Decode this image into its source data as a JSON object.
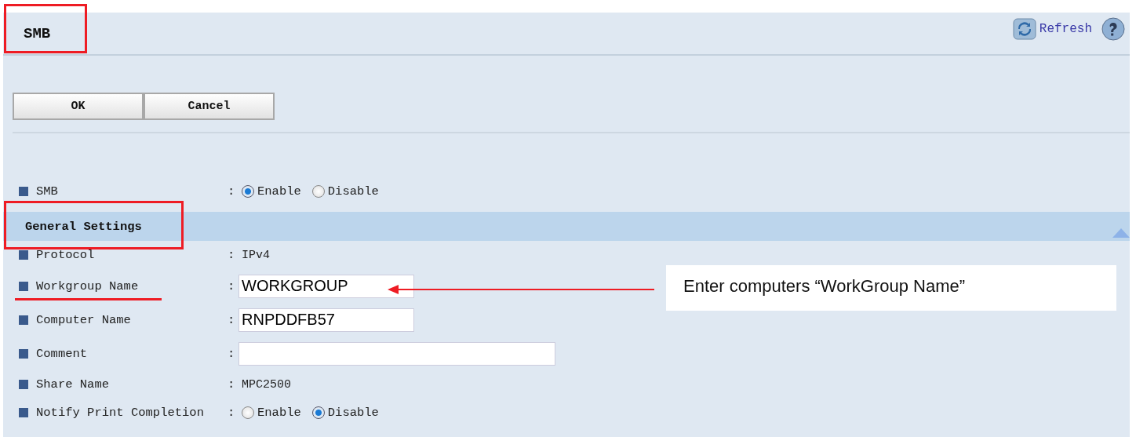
{
  "header": {
    "title": "SMB",
    "refresh": "Refresh"
  },
  "buttons": [
    "OK",
    "Cancel"
  ],
  "top_rows": [
    {
      "kind": "radio",
      "label": "SMB",
      "separator": ":",
      "options": [
        {
          "label": "Enable",
          "selected": true
        },
        {
          "label": "Disable",
          "selected": false
        }
      ]
    }
  ],
  "section": {
    "title": "General Settings",
    "expanded": true
  },
  "rows": [
    {
      "kind": "text",
      "label": "Protocol",
      "separator": ":",
      "value": "IPv4"
    },
    {
      "kind": "input",
      "label": "Workgroup Name",
      "separator": ":",
      "value": "WORKGROUP"
    },
    {
      "kind": "input",
      "label": "Computer Name",
      "separator": ":",
      "value": "RNPDDFB57"
    },
    {
      "kind": "wide_input",
      "label": "Comment",
      "separator": ":"
    },
    {
      "kind": "text",
      "label": "Share Name",
      "separator": ":",
      "value": "MPC2500"
    },
    {
      "kind": "radio",
      "label": "Notify Print Completion",
      "separator": ":",
      "options": [
        {
          "label": "Enable",
          "selected": false
        },
        {
          "label": "Disable",
          "selected": true
        }
      ]
    }
  ],
  "annotation": {
    "callout": "Enter computers “WorkGroup Name”"
  }
}
